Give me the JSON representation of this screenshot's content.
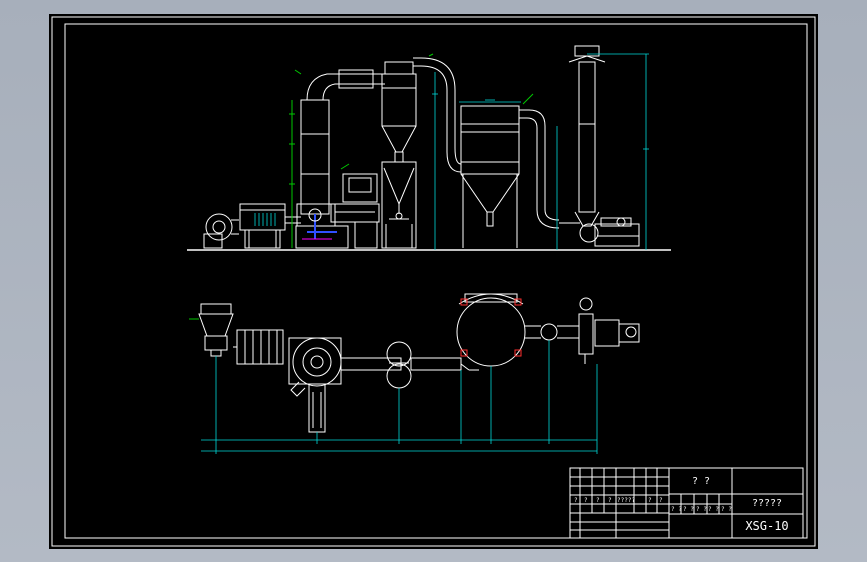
{
  "title_block": {
    "label_a": "? ?",
    "label_b": "?????",
    "drawing_no": "XSG-10",
    "cells_row1": [
      "?",
      "?",
      "?",
      "?",
      "?????",
      "?",
      "?"
    ],
    "cells_row2": [
      "? ?",
      "? ?",
      "? ?",
      "? ?",
      "? ?"
    ]
  },
  "colors": {
    "background": "#000000",
    "outline": "#ffffff",
    "dimension": "#00d8d8",
    "annotation": "#00c800",
    "accent": "#ff00ff",
    "chrome": "#a9b1bd"
  }
}
